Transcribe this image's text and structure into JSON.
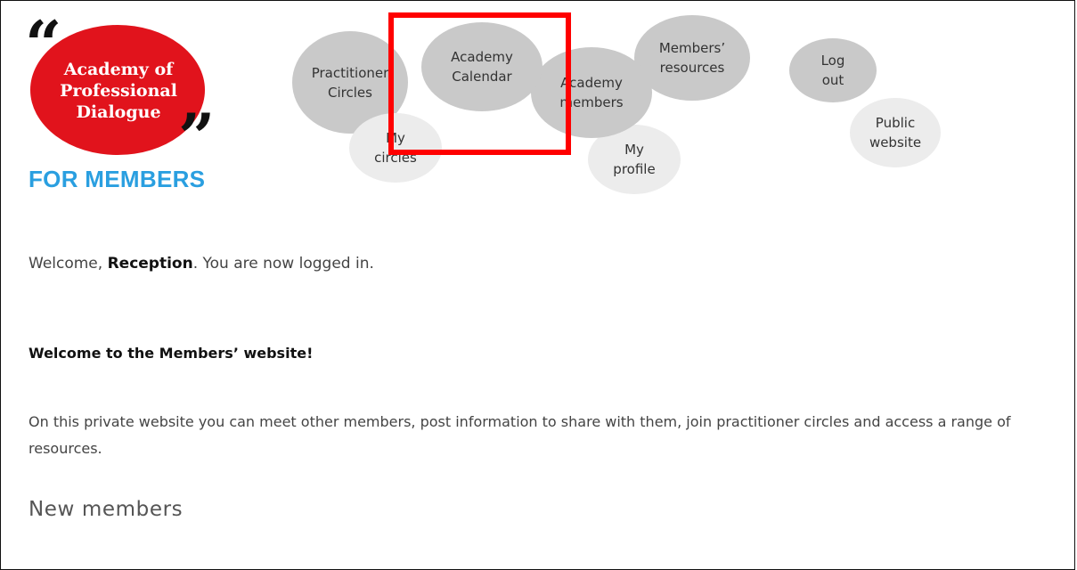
{
  "logo": {
    "quote_open": "“",
    "line1": "Academy of",
    "line2": "Professional",
    "line3": "Dialogue",
    "quote_close": "”",
    "tagline": "FOR MEMBERS",
    "brand_color": "#e1131c",
    "tagline_color": "#2a9fe0"
  },
  "nav": {
    "practitioner_circles": "Practitioner\nCircles",
    "my_circles": "My\ncircles",
    "academy_calendar": "Academy\nCalendar",
    "academy_members": "Academy\nmembers",
    "my_profile": "My\nprofile",
    "members_resources": "Members’\nresources",
    "log_out": "Log\nout",
    "public_website": "Public\nwebsite"
  },
  "welcome": {
    "prefix": "Welcome, ",
    "name": "Reception",
    "suffix": ". You are now logged in."
  },
  "main": {
    "heading": "Welcome to the Members’ website!",
    "intro": "On this private website you can meet other members, post information to share with them, join practitioner circles and access a range of resources.",
    "new_members_title": "New members"
  },
  "colors": {
    "highlight": "#ff0000",
    "bubble_dark": "#c9c9c9",
    "bubble_light": "#ececec"
  }
}
